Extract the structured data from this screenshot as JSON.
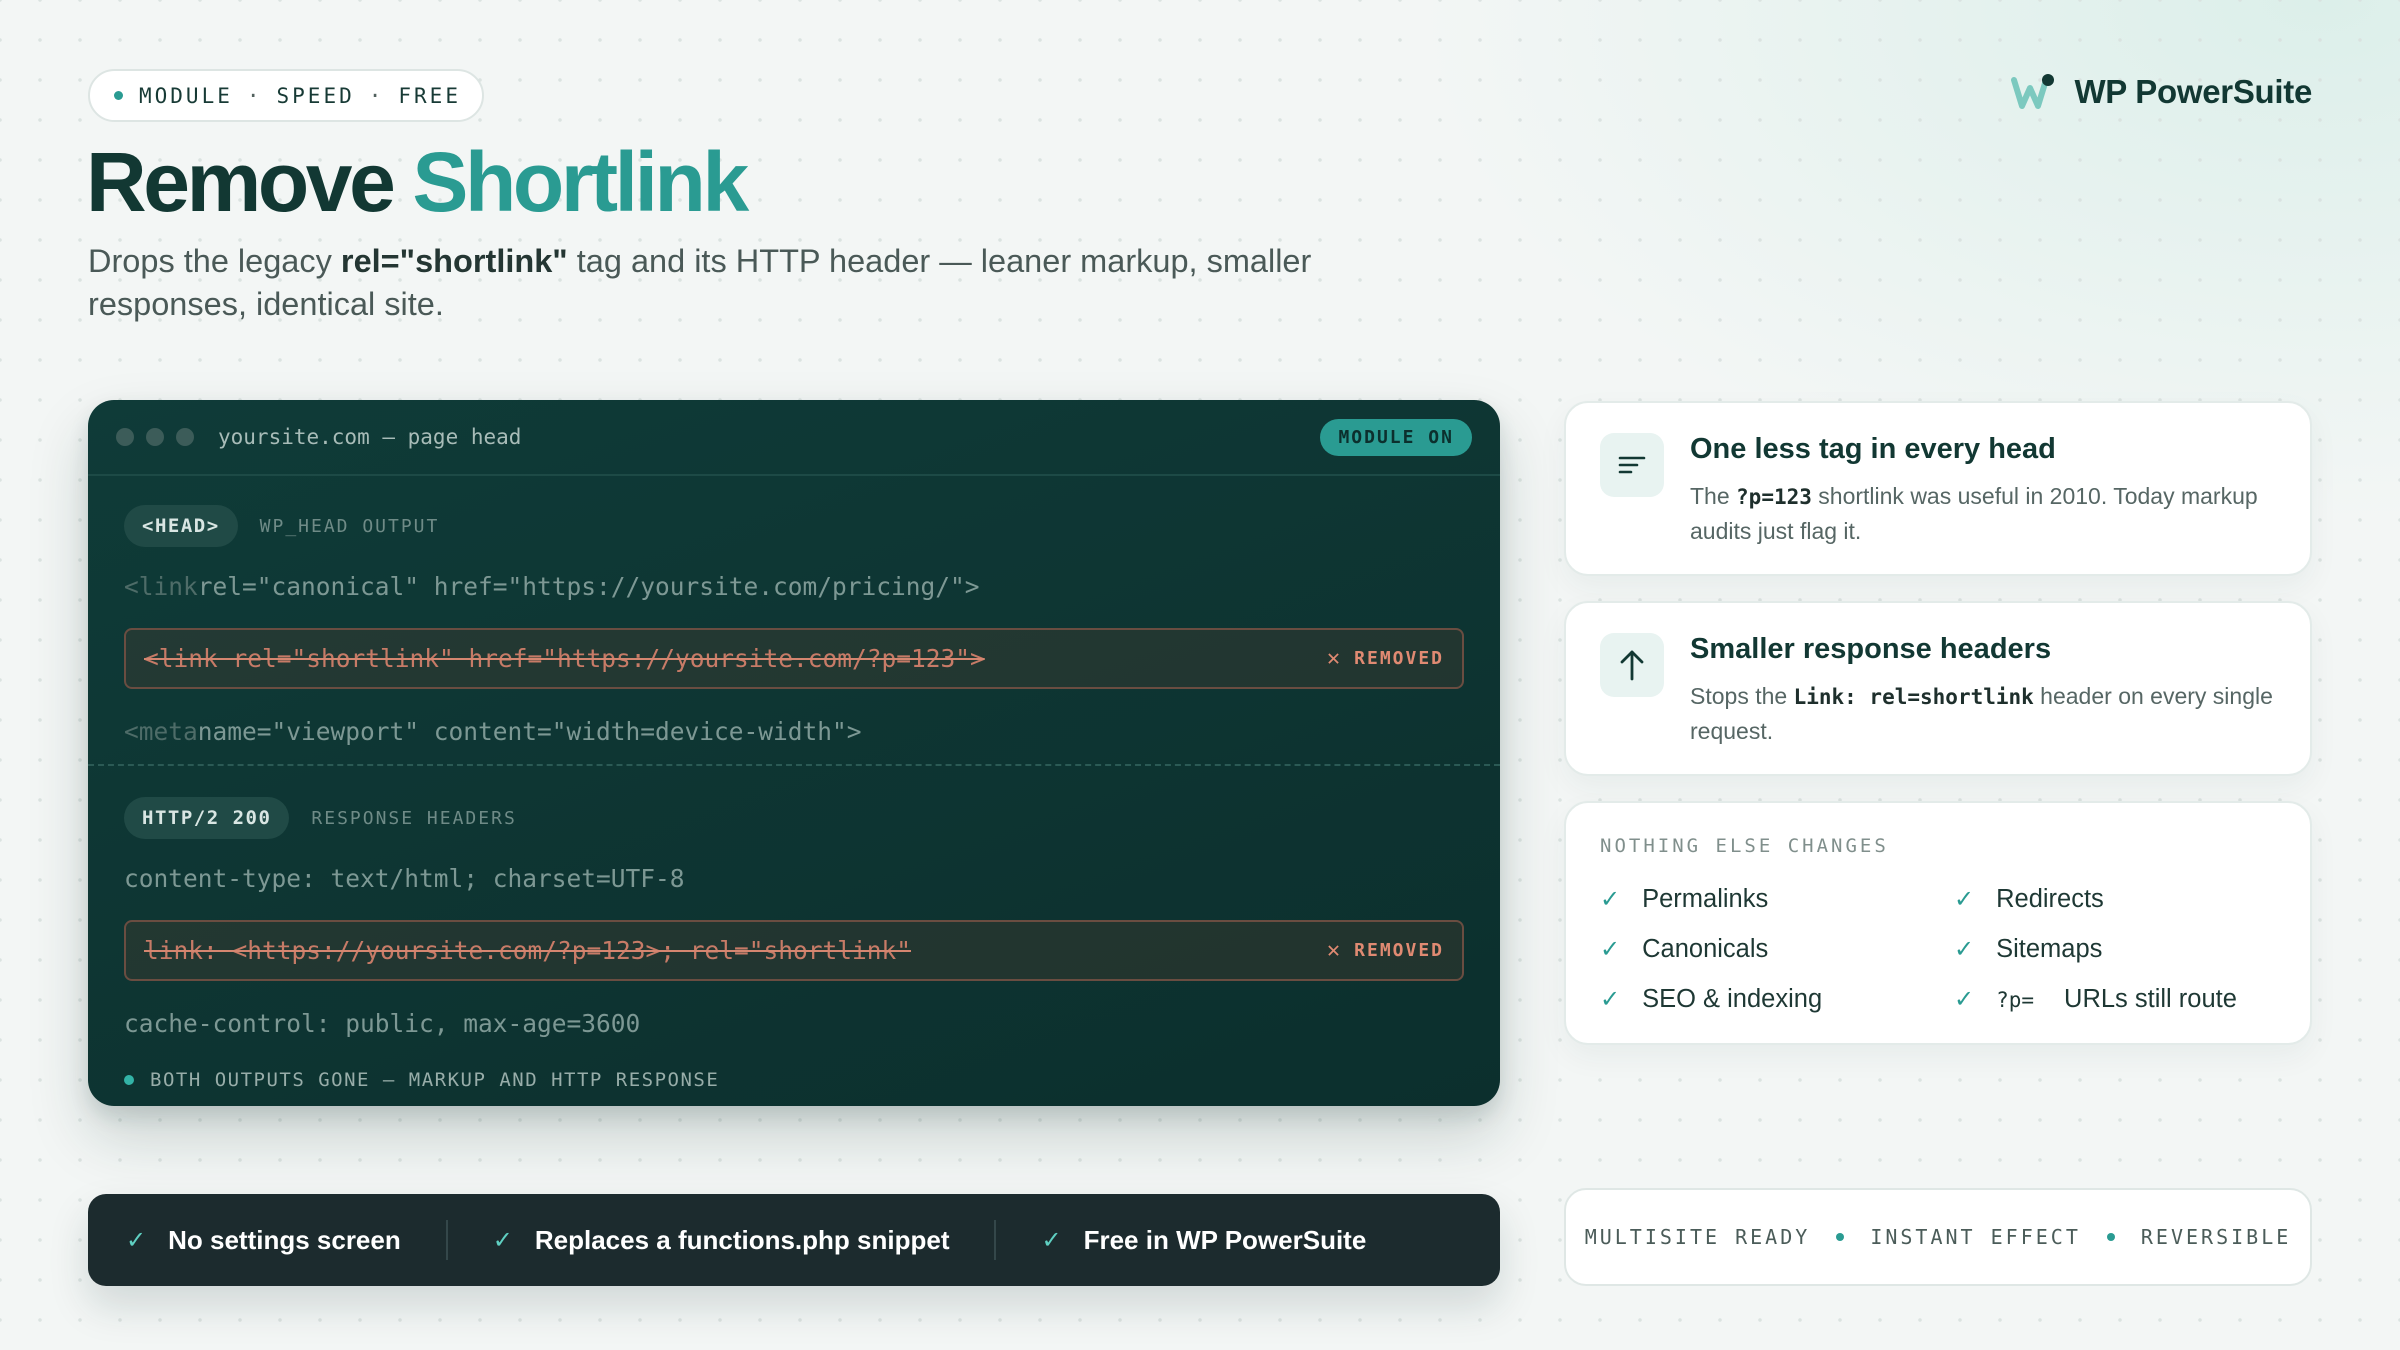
{
  "header": {
    "pill": [
      "MODULE",
      "SPEED",
      "FREE"
    ],
    "pill_sep": "·",
    "brand": "WP PowerSuite",
    "title_main": "Remove",
    "title_accent": "Shortlink",
    "subtitle_pre": "Drops the legacy ",
    "subtitle_bold": "rel=\"shortlink\"",
    "subtitle_post": " tag and its HTTP header — leaner markup, smaller responses, identical site."
  },
  "terminal": {
    "url": "yoursite.com — page head",
    "status": "MODULE ON",
    "head_section": {
      "tag": "<HEAD>",
      "label": "WP_HEAD OUTPUT",
      "line1_tag": "<link",
      "line1_rest": " rel=\"canonical\" href=\"https://yoursite.com/pricing/\">",
      "removed_line": "<link rel=\"shortlink\" href=\"https://yoursite.com/?p=123\">",
      "removed_label": "REMOVED",
      "line3_tag": "<meta",
      "line3_rest": " name=\"viewport\" content=\"width=device-width\">"
    },
    "http_section": {
      "tag": "HTTP/2 200",
      "label": "RESPONSE HEADERS",
      "line1": "content-type: text/html; charset=UTF-8",
      "removed_line": "link: <https://yoursite.com/?p=123>; rel=\"shortlink\"",
      "removed_label": "REMOVED",
      "line3": "cache-control: public, max-age=3600"
    },
    "footnote": "BOTH OUTPUTS GONE — MARKUP AND HTTP RESPONSE"
  },
  "cards": {
    "card1": {
      "title": "One less tag in every head",
      "desc_pre": "The ",
      "desc_code": "?p=123",
      "desc_post": " shortlink was useful in 2010. Today markup audits just flag it."
    },
    "card2": {
      "title": "Smaller response headers",
      "desc_pre": "Stops the ",
      "desc_code": "Link: rel=shortlink",
      "desc_post": " header on every single request."
    },
    "nothing_else": {
      "label": "NOTHING ELSE CHANGES",
      "items": [
        "Permalinks",
        "Redirects",
        "Canonicals",
        "Sitemaps",
        "SEO & indexing"
      ],
      "last_code": "?p=",
      "last_text": "URLs still route"
    }
  },
  "bottom_bar": [
    "No settings screen",
    "Replaces a functions.php snippet",
    "Free in WP PowerSuite"
  ],
  "badges": [
    "MULTISITE READY",
    "INSTANT EFFECT",
    "REVERSIBLE"
  ],
  "colors": {
    "accent": "#2a9b92",
    "ink": "#123833",
    "terminal_bg": "#0f3b38",
    "removed": "#c77b67"
  },
  "icons": {
    "check": "✓",
    "close": "✕",
    "card1_icon": "lines-icon",
    "card2_icon": "arrow-up-icon"
  }
}
